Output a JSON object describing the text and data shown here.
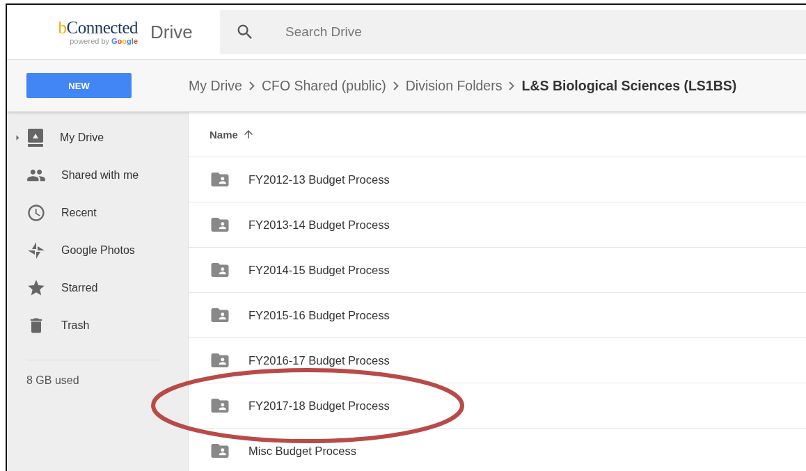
{
  "header": {
    "logo": "bConnected",
    "logo_tagline": "powered by",
    "logo_brand": "Google",
    "app_name": "Drive",
    "search": {
      "placeholder": "Search Drive"
    }
  },
  "new_button": "NEW",
  "breadcrumb": [
    {
      "label": "My Drive",
      "current": false
    },
    {
      "label": "CFO Shared (public)",
      "current": false
    },
    {
      "label": "Division Folders",
      "current": false
    },
    {
      "label": "L&S Biological Sciences (LS1BS)",
      "current": true
    }
  ],
  "sidebar": {
    "items": [
      {
        "label": "My Drive",
        "kind": "drive",
        "expandable": true
      },
      {
        "label": "Shared with me",
        "kind": "shared",
        "expandable": false
      },
      {
        "label": "Recent",
        "kind": "recent",
        "expandable": false
      },
      {
        "label": "Google Photos",
        "kind": "photos",
        "expandable": false
      },
      {
        "label": "Starred",
        "kind": "starred",
        "expandable": false
      },
      {
        "label": "Trash",
        "kind": "trash",
        "expandable": false
      }
    ],
    "storage": "8 GB used"
  },
  "table": {
    "columns": [
      {
        "label": "Name",
        "sorted_ascending": true
      }
    ],
    "rows": [
      {
        "name": "FY2012-13 Budget Process"
      },
      {
        "name": "FY2013-14 Budget Process"
      },
      {
        "name": "FY2014-15 Budget Process"
      },
      {
        "name": "FY2015-16 Budget Process"
      },
      {
        "name": "FY2016-17 Budget Process"
      },
      {
        "name": "FY2017-18 Budget Process"
      },
      {
        "name": "Misc Budget Process"
      }
    ]
  }
}
